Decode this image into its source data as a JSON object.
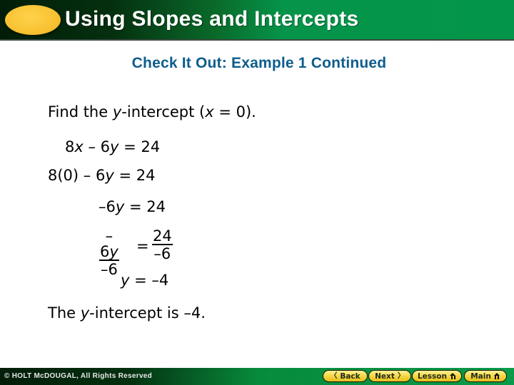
{
  "header": {
    "title": "Using Slopes and Intercepts",
    "colors": {
      "oval": "#f8c232",
      "gradient_dark": "#021d09",
      "gradient_green": "#039648"
    }
  },
  "subtitle": "Check It Out: Example 1 Continued",
  "subtitle_color": "#0d5d8c",
  "content": {
    "intro": {
      "pre": "Find the ",
      "var": "y",
      "mid": "-intercept (",
      "var2": "x",
      "post": " = 0)."
    },
    "steps": [
      {
        "parts": [
          "8",
          "x",
          " – 6",
          "y",
          " = 24"
        ]
      },
      {
        "parts": [
          "8(0) – 6",
          "y",
          " = 24"
        ]
      },
      {
        "parts": [
          "–6",
          "y",
          " = 24"
        ]
      }
    ],
    "fraction_step": {
      "left_num_a": "–6",
      "left_num_var": "y",
      "left_den": "–6",
      "equals": "=",
      "right_num": "24",
      "right_den": "–6"
    },
    "result": {
      "var": "y",
      "rest": " = –4"
    },
    "conclusion": {
      "pre": "The ",
      "var": "y",
      "post": "-intercept is –4."
    }
  },
  "footer": {
    "copyright": "© HOLT McDOUGAL, All Rights Reserved",
    "nav": [
      {
        "label": "Back",
        "icon": "chevron-left-icon",
        "glyph": "〈"
      },
      {
        "label": "Next",
        "icon": "chevron-right-icon",
        "glyph": "〉"
      },
      {
        "label": "Lesson",
        "icon": "home-icon"
      },
      {
        "label": "Main",
        "icon": "home-icon"
      }
    ],
    "button_color": "#f6d94a"
  }
}
